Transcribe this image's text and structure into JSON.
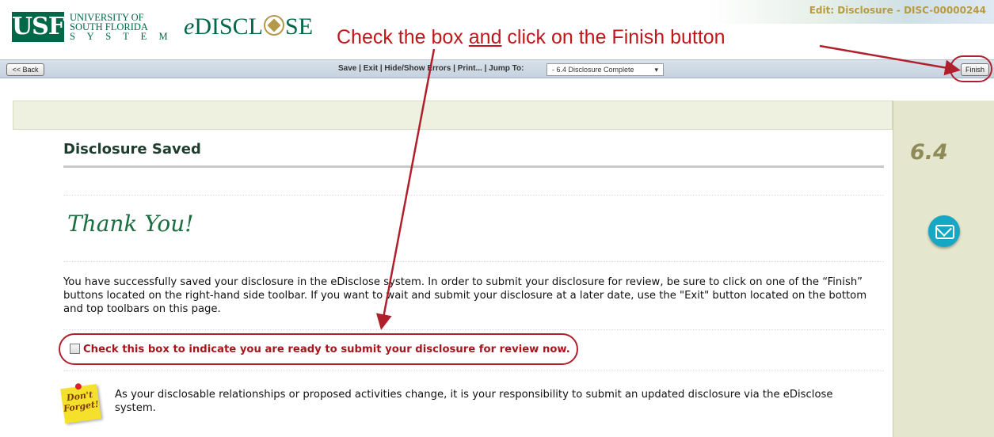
{
  "header": {
    "usf_logo": "USF",
    "university_line1": "UNIVERSITY OF",
    "university_line2": "SOUTH FLORIDA",
    "university_line3": "S Y S T E M",
    "app_name_prefix": "e",
    "app_name_part1": "DISCL",
    "app_name_part2": "SE",
    "edit_title": "Edit: Disclosure - DISC-00000244"
  },
  "annotation": {
    "part1": "Check the box ",
    "underlined": "and",
    "part2": " click on the Finish button"
  },
  "toolbar": {
    "back_label": "<< Back",
    "finish_label": "Finish",
    "save": "Save",
    "exit": "Exit",
    "hide_show_errors": "Hide/Show Errors",
    "print": "Print...",
    "separator": " | ",
    "jump_to_label": "Jump To:",
    "jump_to_selected": "- 6.4 Disclosure Complete"
  },
  "main": {
    "page_title": "Disclosure Saved",
    "step_number": "6.4",
    "thank_you": "Thank You!",
    "body": "You have successfully saved your disclosure in the eDisclose system. In order to submit your disclosure for review, be sure to click on one of the “Finish” buttons located on the right-hand side toolbar. If you want to wait and submit your disclosure at a later date, use the \"Exit\" button located on the bottom and top toolbars on this page.",
    "checkbox_label": "Check this box to indicate you are ready to submit your disclosure for review now.",
    "sticky_line1": "Don't",
    "sticky_line2": "Forget!",
    "reminder": "As your disclosable relationships or proposed activities change, it is your responsibility to submit an updated disclosure via the eDisclose system."
  },
  "icons": {
    "mail": "mail-icon",
    "checkbox": "checkbox-icon",
    "compass": "compass-icon",
    "sticky_note": "sticky-note-icon"
  },
  "colors": {
    "brand_green": "#006747",
    "annotation_red": "#c0171b",
    "accent_gold": "#b89a43",
    "side_panel": "#e4e6cd",
    "mail_teal": "#16a7c5"
  }
}
